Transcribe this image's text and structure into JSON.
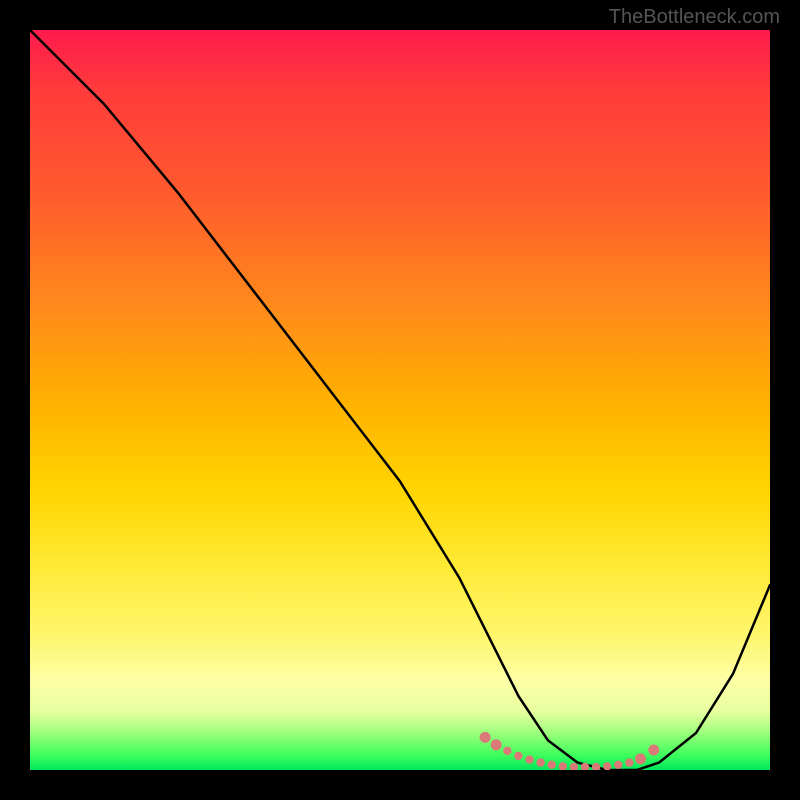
{
  "watermark": "TheBottleneck.com",
  "chart_data": {
    "type": "line",
    "title": "",
    "xlabel": "",
    "ylabel": "",
    "xlim": [
      0,
      100
    ],
    "ylim": [
      0,
      100
    ],
    "series": [
      {
        "name": "curve",
        "color": "#000000",
        "x": [
          0,
          4,
          10,
          20,
          30,
          40,
          50,
          58,
          62,
          66,
          70,
          74,
          78,
          82,
          85,
          90,
          95,
          100
        ],
        "values": [
          100,
          96,
          90,
          78,
          65,
          52,
          39,
          26,
          18,
          10,
          4,
          1,
          0,
          0,
          1,
          5,
          13,
          25
        ]
      }
    ],
    "markers": {
      "name": "dotted-band",
      "color": "#d97a78",
      "x": [
        61.5,
        63,
        64.5,
        66,
        67.5,
        69,
        70.5,
        72,
        73.5,
        75,
        76.5,
        78,
        79.5,
        81,
        82.5,
        84.3
      ],
      "y": [
        4.4,
        3.4,
        2.6,
        1.9,
        1.4,
        1.0,
        0.7,
        0.5,
        0.4,
        0.4,
        0.4,
        0.5,
        0.7,
        1.0,
        1.5,
        2.7
      ]
    }
  }
}
